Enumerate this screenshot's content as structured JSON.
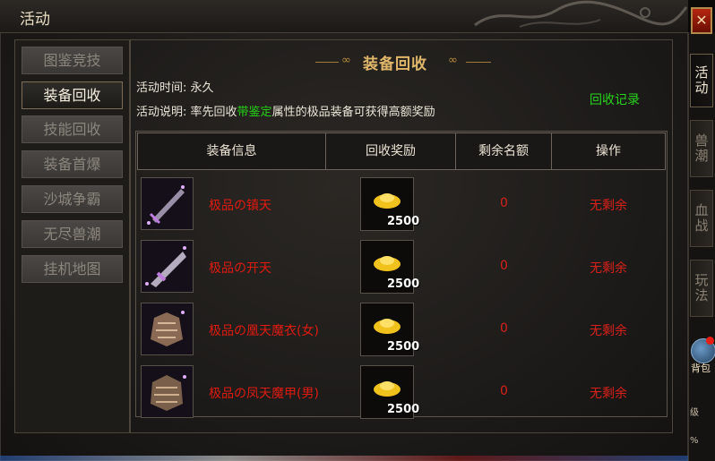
{
  "window": {
    "title": "活动",
    "close_label": "✕"
  },
  "side_tabs": [
    {
      "label": "活动",
      "active": true
    },
    {
      "label": "兽潮",
      "active": false
    },
    {
      "label": "血战",
      "active": false
    },
    {
      "label": "玩法",
      "active": false
    }
  ],
  "bag": {
    "label": "背包"
  },
  "strip_small": [
    "级",
    "%"
  ],
  "nav": [
    {
      "label": "图鉴竞技",
      "active": false
    },
    {
      "label": "装备回收",
      "active": true
    },
    {
      "label": "技能回收",
      "active": false
    },
    {
      "label": "装备首爆",
      "active": false
    },
    {
      "label": "沙城争霸",
      "active": false
    },
    {
      "label": "无尽兽潮",
      "active": false
    },
    {
      "label": "挂机地图",
      "active": false
    }
  ],
  "panel": {
    "heading": "装备回收",
    "time_label": "活动时间:",
    "time_value": "永久",
    "desc_label": "活动说明:",
    "desc_prefix": "率先回收",
    "desc_highlight": "带鉴定",
    "desc_suffix": "属性的极品装备可获得高额奖励",
    "record_link": "回收记录"
  },
  "table": {
    "headers": [
      "装备信息",
      "回收奖励",
      "剩余名额",
      "操作"
    ],
    "rows": [
      {
        "item_name": "极品の镇天",
        "item_icon": "sword-icon",
        "reward_icon": "gold-ingot-icon",
        "reward_count": "2500",
        "remaining": "0",
        "action": "无剩余"
      },
      {
        "item_name": "极品の开天",
        "item_icon": "blade-icon",
        "reward_icon": "gold-ingot-icon",
        "reward_count": "2500",
        "remaining": "0",
        "action": "无剩余"
      },
      {
        "item_name": "极品の凰天魔衣(女)",
        "item_icon": "armor-icon",
        "reward_icon": "gold-ingot-icon",
        "reward_count": "2500",
        "remaining": "0",
        "action": "无剩余"
      },
      {
        "item_name": "极品の凤天魔甲(男)",
        "item_icon": "armor-icon",
        "reward_icon": "gold-ingot-icon",
        "reward_count": "2500",
        "remaining": "0",
        "action": "无剩余"
      }
    ]
  },
  "colors": {
    "accent_gold": "#e0b66a",
    "highlight_green": "#23d115",
    "warning_red": "#d8201a"
  }
}
